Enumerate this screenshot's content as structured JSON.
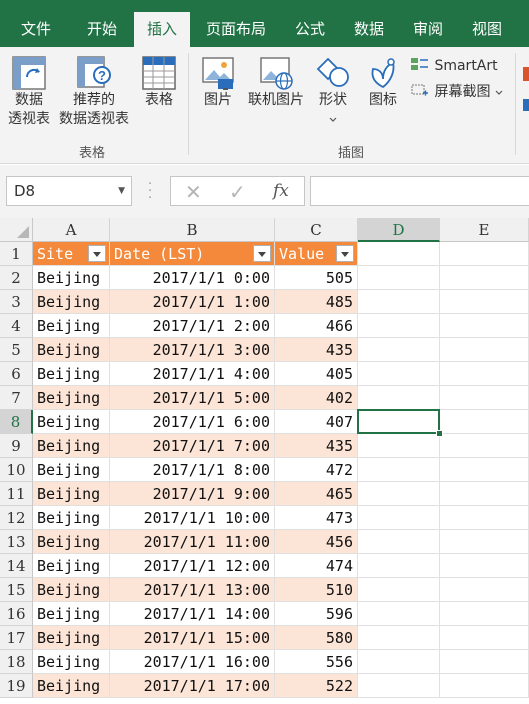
{
  "ribbon_tabs": [
    {
      "label": "文件",
      "active": false
    },
    {
      "label": "开始",
      "active": false
    },
    {
      "label": "插入",
      "active": true
    },
    {
      "label": "页面布局",
      "active": false
    },
    {
      "label": "公式",
      "active": false
    },
    {
      "label": "数据",
      "active": false
    },
    {
      "label": "审阅",
      "active": false
    },
    {
      "label": "视图",
      "active": false
    }
  ],
  "ribbon": {
    "pivot_table_line1": "数据",
    "pivot_table_line2": "透视表",
    "recommended_pivot_line1": "推荐的",
    "recommended_pivot_line2": "数据透视表",
    "table": "表格",
    "group_tables": "表格",
    "pictures": "图片",
    "online_pictures": "联机图片",
    "shapes": "形状",
    "icons": "图标",
    "smartart": "SmartArt",
    "screenshot": "屏幕截图",
    "group_illustrations": "插图"
  },
  "formula_bar": {
    "name_box": "D8",
    "cancel_symbol": "✕",
    "enter_symbol": "✓",
    "fx_label": "fx",
    "formula": ""
  },
  "column_headers": [
    "A",
    "B",
    "C",
    "D",
    "E"
  ],
  "selected_column": "D",
  "selected_row": "8",
  "active_cell": "D8",
  "table": {
    "headers": [
      "Site",
      "Date (LST)",
      "Value"
    ],
    "rows": [
      [
        "Beijing",
        "2017/1/1 0:00",
        "505"
      ],
      [
        "Beijing",
        "2017/1/1 1:00",
        "485"
      ],
      [
        "Beijing",
        "2017/1/1 2:00",
        "466"
      ],
      [
        "Beijing",
        "2017/1/1 3:00",
        "435"
      ],
      [
        "Beijing",
        "2017/1/1 4:00",
        "405"
      ],
      [
        "Beijing",
        "2017/1/1 5:00",
        "402"
      ],
      [
        "Beijing",
        "2017/1/1 6:00",
        "407"
      ],
      [
        "Beijing",
        "2017/1/1 7:00",
        "435"
      ],
      [
        "Beijing",
        "2017/1/1 8:00",
        "472"
      ],
      [
        "Beijing",
        "2017/1/1 9:00",
        "465"
      ],
      [
        "Beijing",
        "2017/1/1 10:00",
        "473"
      ],
      [
        "Beijing",
        "2017/1/1 11:00",
        "456"
      ],
      [
        "Beijing",
        "2017/1/1 12:00",
        "474"
      ],
      [
        "Beijing",
        "2017/1/1 13:00",
        "510"
      ],
      [
        "Beijing",
        "2017/1/1 14:00",
        "596"
      ],
      [
        "Beijing",
        "2017/1/1 15:00",
        "580"
      ],
      [
        "Beijing",
        "2017/1/1 16:00",
        "556"
      ],
      [
        "Beijing",
        "2017/1/1 17:00",
        "522"
      ]
    ]
  },
  "row_numbers": [
    "1",
    "2",
    "3",
    "4",
    "5",
    "6",
    "7",
    "8",
    "9",
    "10",
    "11",
    "12",
    "13",
    "14",
    "15",
    "16",
    "17",
    "18",
    "19"
  ],
  "colors": {
    "accent": "#217346",
    "table_header": "#f4893b",
    "table_band": "#fce4d6"
  }
}
